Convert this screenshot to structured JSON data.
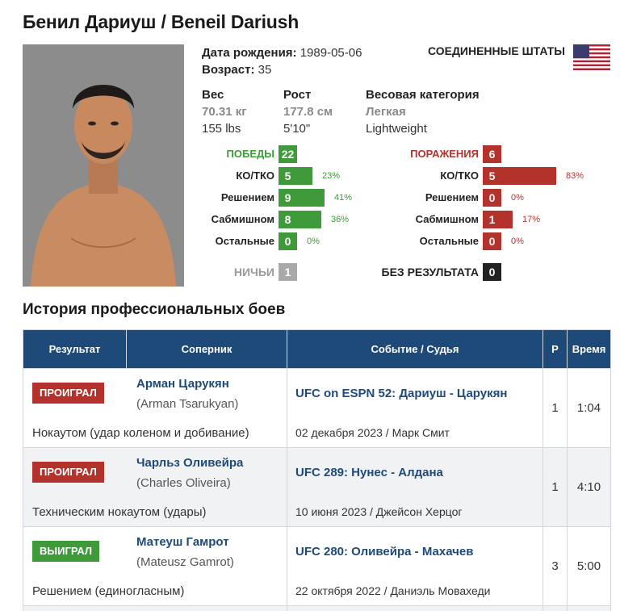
{
  "fighter": {
    "name": "Бенил Дариуш / Beneil Dariush",
    "dob_label": "Дата рождения:",
    "dob": "1989-05-06",
    "age_label": "Возраст:",
    "age": "35",
    "country": "СОЕДИНЕННЫЕ ШТАТЫ",
    "flag_icon": "us-flag-icon"
  },
  "physical": {
    "weight_label": "Вес",
    "weight_kg": "70.31 кг",
    "weight_lbs": "155 lbs",
    "height_label": "Рост",
    "height_cm": "177.8 см",
    "height_ft": "5'10\"",
    "class_label": "Весовая категория",
    "class_ru": "Легкая",
    "class_en": "Lightweight"
  },
  "record": {
    "wins": {
      "label": "ПОБЕДЫ",
      "total": "22",
      "rows": [
        {
          "label": "КО/ТКО",
          "count": "5",
          "pct": "23%",
          "frac": 0.23
        },
        {
          "label": "Решением",
          "count": "9",
          "pct": "41%",
          "frac": 0.41
        },
        {
          "label": "Сабмишном",
          "count": "8",
          "pct": "36%",
          "frac": 0.36
        },
        {
          "label": "Остальные",
          "count": "0",
          "pct": "0%",
          "frac": 0
        }
      ]
    },
    "losses": {
      "label": "ПОРАЖЕНИЯ",
      "total": "6",
      "rows": [
        {
          "label": "КО/ТКО",
          "count": "5",
          "pct": "83%",
          "frac": 0.83
        },
        {
          "label": "Решением",
          "count": "0",
          "pct": "0%",
          "frac": 0
        },
        {
          "label": "Сабмишном",
          "count": "1",
          "pct": "17%",
          "frac": 0.17
        },
        {
          "label": "Остальные",
          "count": "0",
          "pct": "0%",
          "frac": 0
        }
      ]
    },
    "draws_label": "НИЧЬИ",
    "draws": "1",
    "nc_label": "БЕЗ РЕЗУЛЬТАТА",
    "nc": "0"
  },
  "history": {
    "title": "История профессиональных боев",
    "headers": {
      "result": "Результат",
      "opponent": "Соперник",
      "event": "Событие / Судья",
      "round": "Р",
      "time": "Время"
    },
    "fights": [
      {
        "result": "ПРОИГРАЛ",
        "result_color": "#b3322c",
        "opp_ru": "Арман Царукян",
        "opp_en": "(Arman Tsarukyan)",
        "method": "Нокаутом (удар коленом и добивание)",
        "event": "UFC on ESPN 52: Дариуш - Царукян",
        "date_ref": "02 декабря 2023 / Марк Смит",
        "round": "1",
        "time": "1:04"
      },
      {
        "result": "ПРОИГРАЛ",
        "result_color": "#b3322c",
        "opp_ru": "Чарльз Оливейра",
        "opp_en": "(Charles Oliveira)",
        "method": "Техническим нокаутом (удары)",
        "event": "UFC 289: Нунес - Алдана",
        "date_ref": "10 июня 2023 / Джейсон Херцог",
        "round": "1",
        "time": "4:10"
      },
      {
        "result": "ВЫИГРАЛ",
        "result_color": "#3f9a3a",
        "opp_ru": "Матеуш Гамрот",
        "opp_en": "(Mateusz Gamrot)",
        "method": "Решением (единогласным)",
        "event": "UFC 280: Оливейра - Махачев",
        "date_ref": "22 октября 2022 / Даниэль Мовахеди",
        "round": "3",
        "time": "5:00"
      }
    ]
  }
}
